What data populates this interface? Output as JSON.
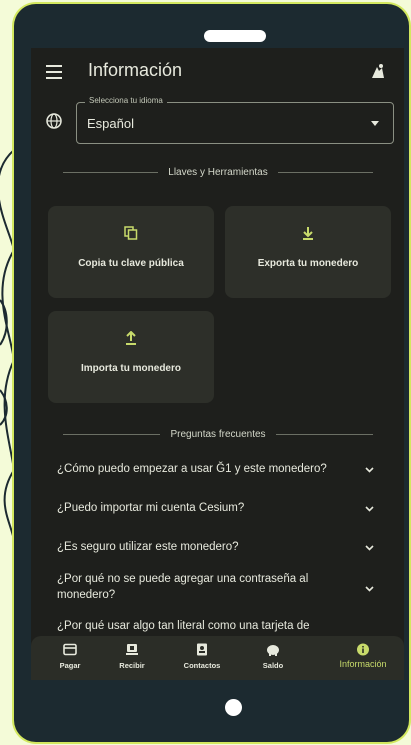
{
  "appbar": {
    "title": "Información",
    "menu_icon": "menu-icon",
    "theme_icon": "theme-toggle-icon"
  },
  "language": {
    "label": "Selecciona tu idioma",
    "value": "Español",
    "icon": "globe-icon"
  },
  "tools": {
    "section_title": "Llaves y Herramientas",
    "cards": [
      {
        "label": "Copia tu clave pública",
        "icon": "copy-icon"
      },
      {
        "label": "Exporta tu monedero",
        "icon": "download-icon"
      },
      {
        "label": "Importa tu monedero",
        "icon": "upload-icon"
      }
    ]
  },
  "faq": {
    "section_title": "Preguntas frecuentes",
    "items": [
      {
        "question": "¿Cómo puedo empezar a usar Ğ1 y este monedero?"
      },
      {
        "question": "¿Puedo importar mi cuenta Cesium?"
      },
      {
        "question": "¿Es seguro utilizar este monedero?"
      },
      {
        "question": "¿Por qué no se puede agregar una contraseña al monedero?"
      },
      {
        "question": "¿Por qué usar algo tan literal como una tarjeta de"
      }
    ]
  },
  "nav": {
    "items": [
      {
        "label": "Pagar",
        "icon": "card-icon"
      },
      {
        "label": "Recibir",
        "icon": "receive-icon"
      },
      {
        "label": "Contactos",
        "icon": "contacts-icon"
      },
      {
        "label": "Saldo",
        "icon": "piggy-bank-icon"
      },
      {
        "label": "Información",
        "icon": "info-icon"
      }
    ],
    "active_index": 4
  },
  "colors": {
    "accent": "#c8db6b",
    "screen_bg": "#1e1f1c",
    "card_bg": "#2d2f29",
    "frame": "#1c2a30"
  }
}
